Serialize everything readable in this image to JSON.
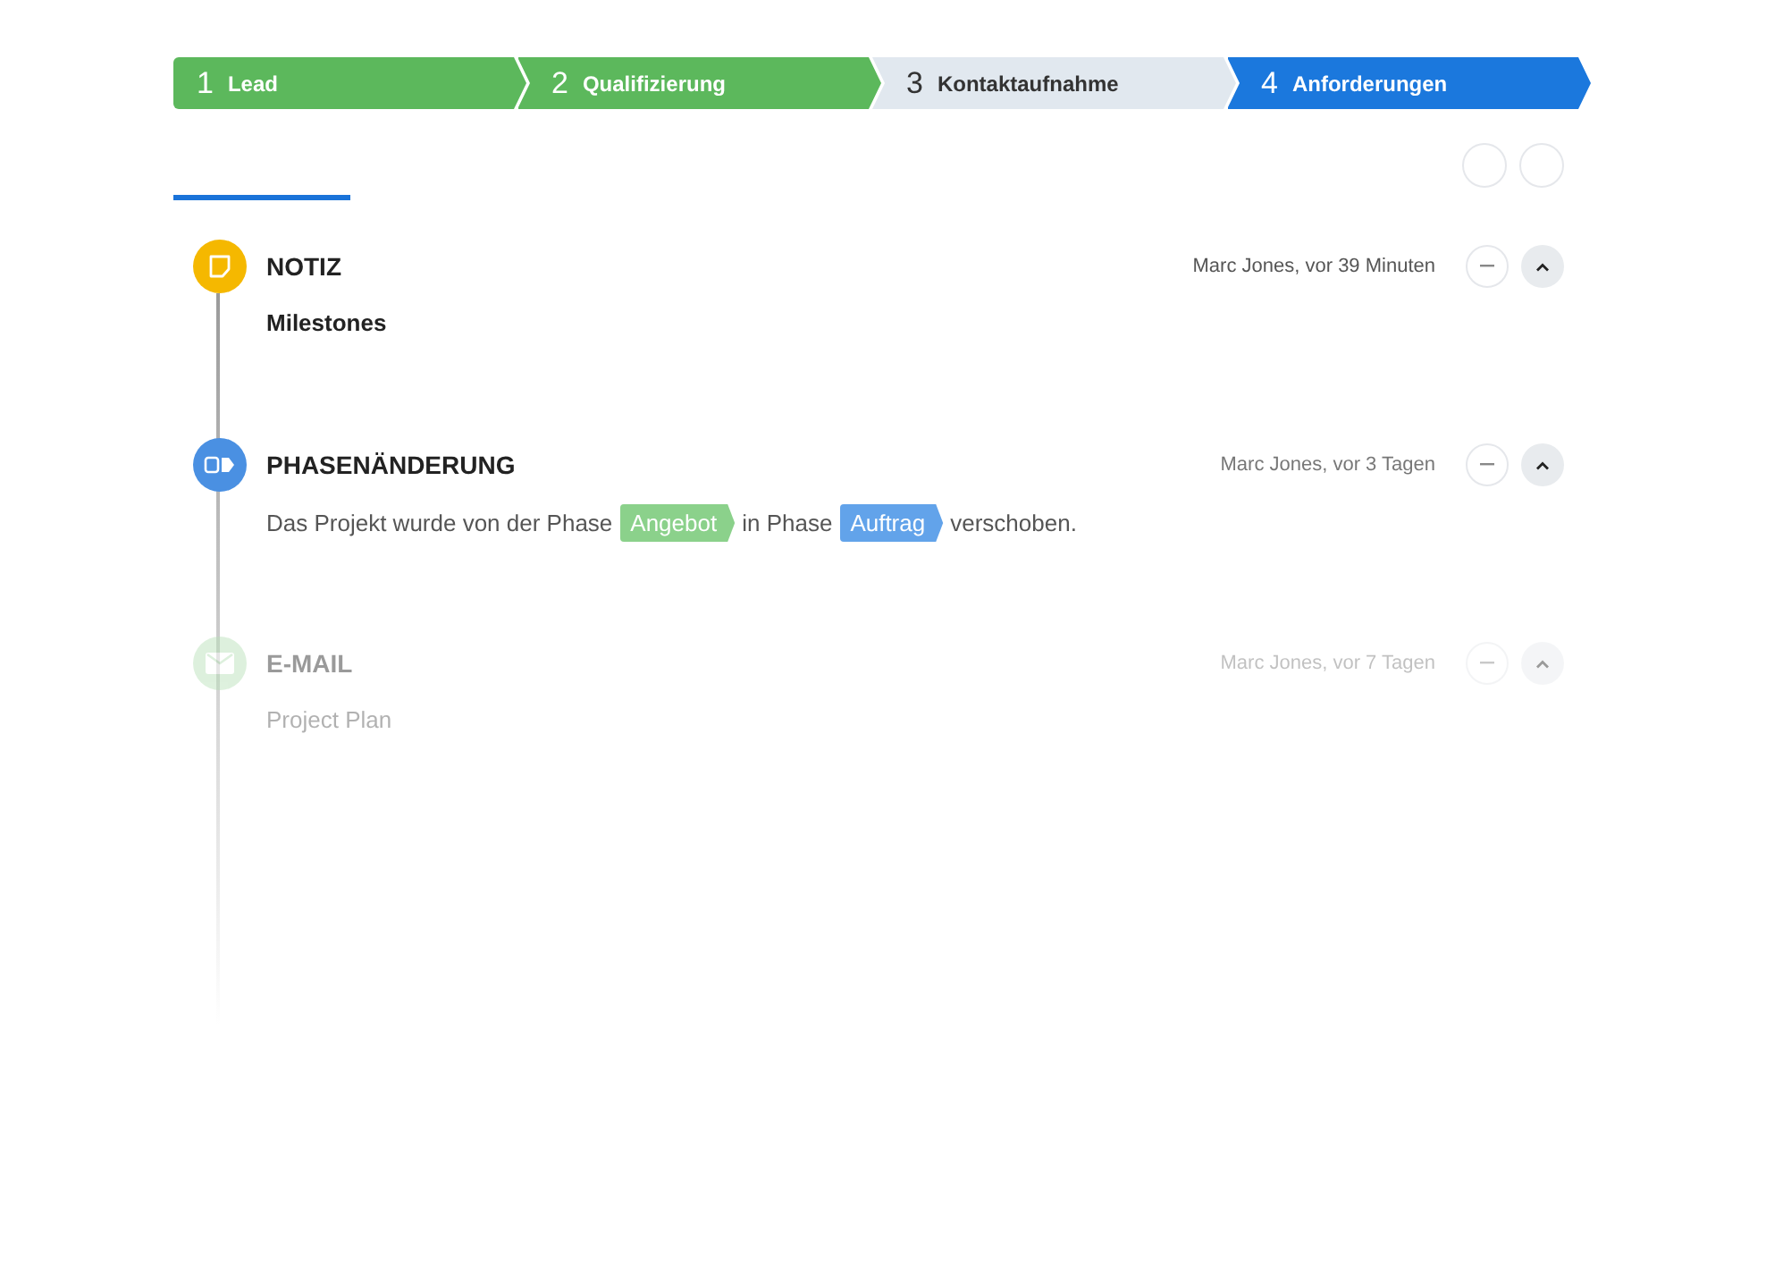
{
  "steps": [
    {
      "number": "1",
      "label": "Lead",
      "kind": "done"
    },
    {
      "number": "2",
      "label": "Qualifizierung",
      "kind": "done"
    },
    {
      "number": "3",
      "label": "Kontaktaufnahme",
      "kind": "todo"
    },
    {
      "number": "4",
      "label": "Anforderungen",
      "kind": "current"
    }
  ],
  "entries": [
    {
      "kind": "note",
      "title": "NOTIZ",
      "meta": "Marc Jones, vor 39 Minuten",
      "faded": false,
      "body": [
        {
          "kind": "bold",
          "text": "Milestones"
        }
      ]
    },
    {
      "kind": "phase",
      "title": "PHASENÄNDERUNG",
      "meta": "Marc Jones, vor 3 Tagen",
      "faded": false,
      "body": [
        {
          "kind": "text",
          "text": "Das Projekt wurde von der Phase"
        },
        {
          "kind": "tag",
          "text": "Angebot",
          "color": "#8bd18b"
        },
        {
          "kind": "text",
          "text": "in Phase"
        },
        {
          "kind": "tag",
          "text": "Auftrag",
          "color": "#62a3ea"
        },
        {
          "kind": "text",
          "text": "verschoben."
        }
      ]
    },
    {
      "kind": "email",
      "title": "E-MAIL",
      "meta": "Marc Jones, vor 7 Tagen",
      "faded": true,
      "body": [
        {
          "kind": "text",
          "text": "Project Plan"
        }
      ]
    }
  ]
}
